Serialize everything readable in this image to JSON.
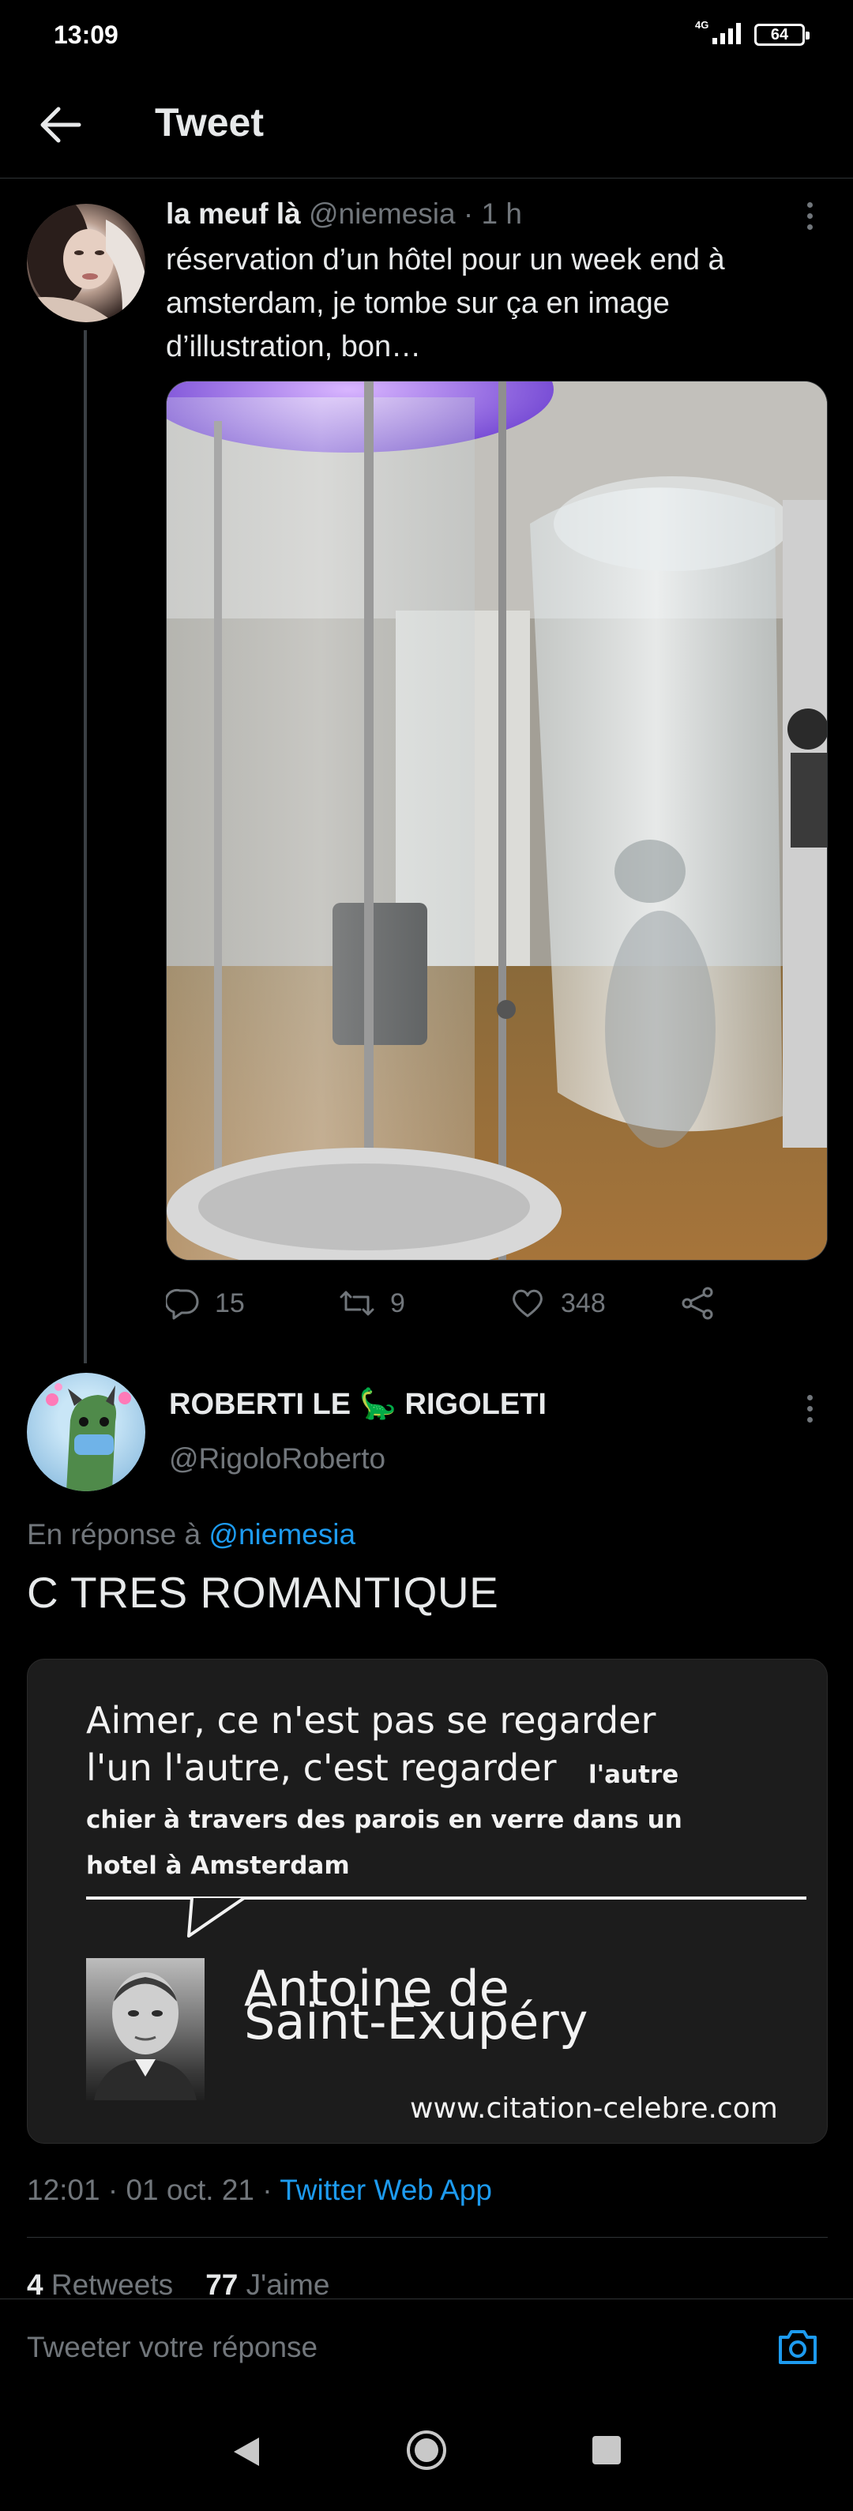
{
  "status_bar": {
    "time": "13:09",
    "network": "4G",
    "battery": "64"
  },
  "header": {
    "title": "Tweet"
  },
  "tweet": {
    "name": "la meuf là",
    "handle": "@niemesia",
    "time": "1 h",
    "text": "réservation d’un hôtel pour un week end à amsterdam, je tombe sur ça en image d’illustration, bon…",
    "replies": "15",
    "retweets": "9",
    "likes": "348"
  },
  "reply": {
    "name": "ROBERTI LE 🦕 RIGOLETI",
    "handle": "@RigoloRoberto",
    "replying_prefix": "En réponse à",
    "replying_to": "@niemesia",
    "text": "C TRES ROMANTIQUE",
    "quote_image": {
      "line1": "Aimer, ce n'est pas se regarder",
      "line2": "l'un l'autre, c'est regarder",
      "line2b": "l'autre",
      "line3": "chier à travers des parois en verre dans un",
      "line4": "hotel à Amsterdam",
      "author_line1": "Antoine de",
      "author_line2": "Saint-Exupéry",
      "site": "www.citation-celebre.com"
    },
    "timestamp": "12:01 · 01 oct. 21 · ",
    "source": "Twitter Web App",
    "retweet_count": "4",
    "retweet_label": "Retweets",
    "like_count": "77",
    "like_label": "J'aime"
  },
  "composer": {
    "placeholder": "Tweeter votre réponse"
  },
  "colors": {
    "accent": "#1d9bf0",
    "muted": "#71767b",
    "text": "#e7e9ea",
    "background": "#000000"
  }
}
